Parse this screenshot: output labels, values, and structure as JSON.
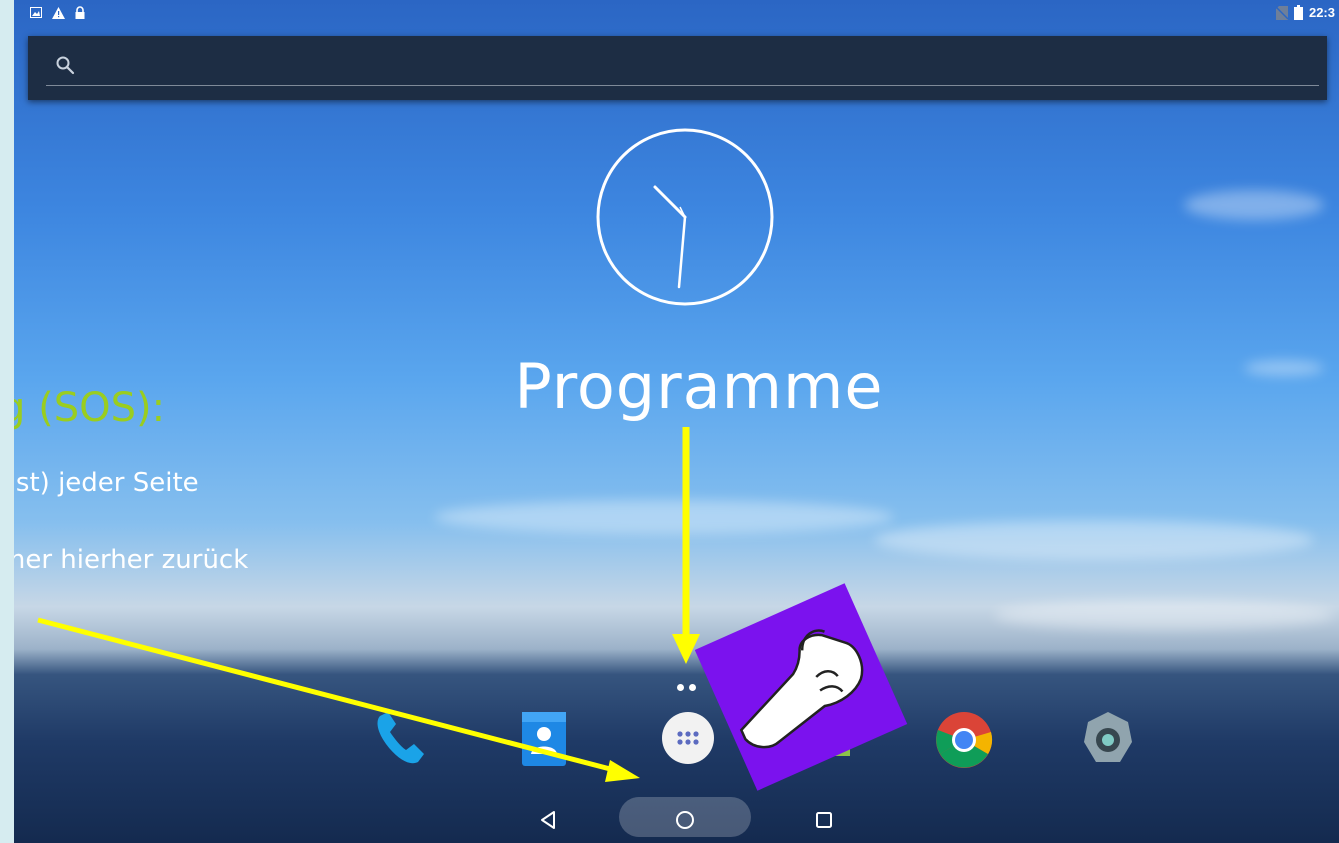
{
  "status_bar": {
    "left_icons": [
      "image-icon",
      "warning-icon",
      "lock-icon"
    ],
    "right_icons": [
      "no-sim-icon",
      "battery-icon"
    ],
    "time": "22:3"
  },
  "search": {
    "placeholder": "",
    "value": ""
  },
  "labels": {
    "programme": "Programme",
    "sos_heading": "g (SOS):",
    "desc_line1": "ast) jeder Seite",
    "desc_line2": "mer hierher zurück"
  },
  "dock": {
    "apps": [
      "phone-icon",
      "contacts-icon",
      "app-drawer-icon",
      "messaging-icon",
      "chrome-icon",
      "camera-icon"
    ]
  },
  "nav": {
    "buttons": [
      "back-button",
      "home-button",
      "recents-button"
    ]
  },
  "colors": {
    "sos_heading": "#9acd1f",
    "arrow": "#ffff00",
    "sticker": "#7b12ee",
    "search_bar": "#1d2d44"
  }
}
